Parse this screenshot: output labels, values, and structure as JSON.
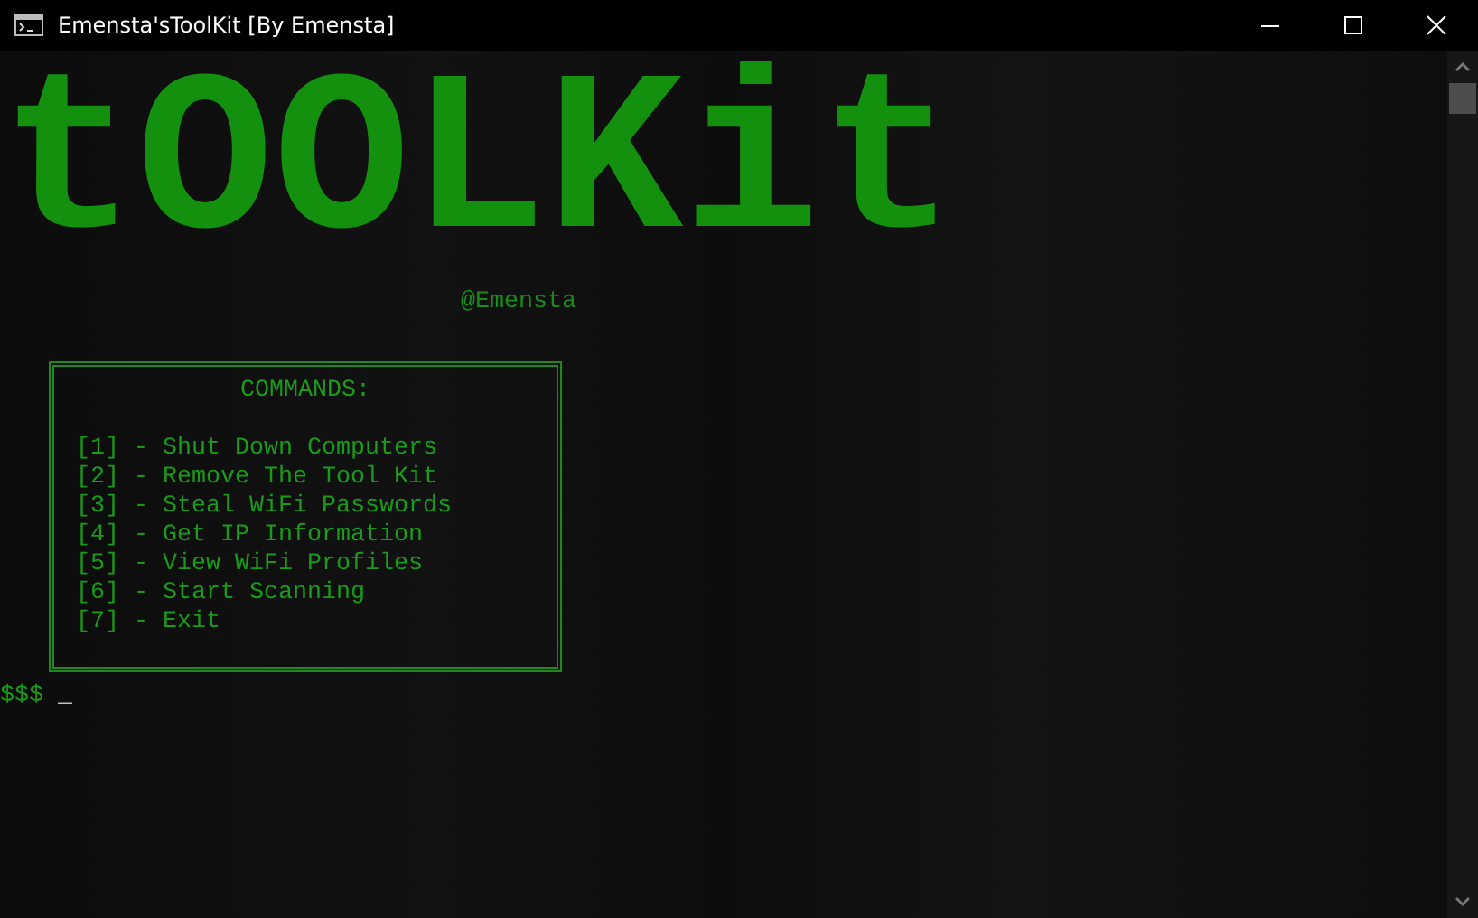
{
  "window": {
    "title": "Emensta'sToolKit [By Emensta]"
  },
  "banner": {
    "art": "tOOLKit",
    "author": "@Emensta"
  },
  "menu": {
    "heading": "COMMANDS:",
    "items": [
      {
        "key": "[1]",
        "label": "- Shut Down Computers"
      },
      {
        "key": "[2]",
        "label": "- Remove The Tool Kit"
      },
      {
        "key": "[3]",
        "label": "- Steal WiFi Passwords"
      },
      {
        "key": "[4]",
        "label": "- Get IP Information"
      },
      {
        "key": "[5]",
        "label": "- View WiFi Profiles"
      },
      {
        "key": "[6]",
        "label": "- Start Scanning"
      },
      {
        "key": "[7]",
        "label": "- Exit"
      }
    ]
  },
  "prompt": {
    "symbol": "$$$",
    "cursor": "_"
  }
}
